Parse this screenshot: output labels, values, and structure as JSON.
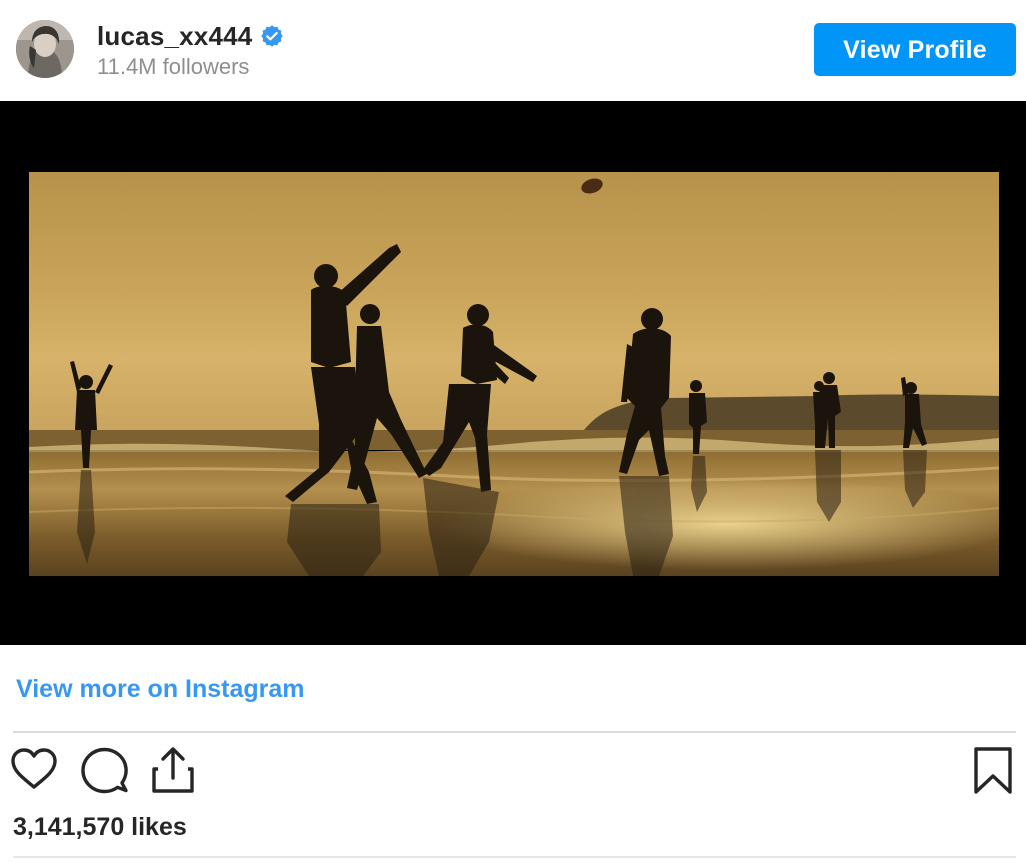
{
  "header": {
    "username": "lucas_xx444",
    "verified": true,
    "followers": "11.4M followers",
    "view_profile_label": "View Profile",
    "avatar_icon": "profile-avatar"
  },
  "media": {
    "kind": "video-still",
    "icon": "beach-football-scene"
  },
  "footer": {
    "view_more_label": "View more on Instagram",
    "actions": [
      {
        "name": "like",
        "icon": "heart-icon"
      },
      {
        "name": "comment",
        "icon": "comment-icon"
      },
      {
        "name": "share",
        "icon": "share-icon"
      },
      {
        "name": "save",
        "icon": "bookmark-icon"
      }
    ],
    "likes": "3,141,570 likes"
  },
  "colors": {
    "accent": "#0095f6",
    "link": "#3897f0",
    "verified": "#3897f0",
    "text": "#262626",
    "muted": "#8e8e8e"
  }
}
